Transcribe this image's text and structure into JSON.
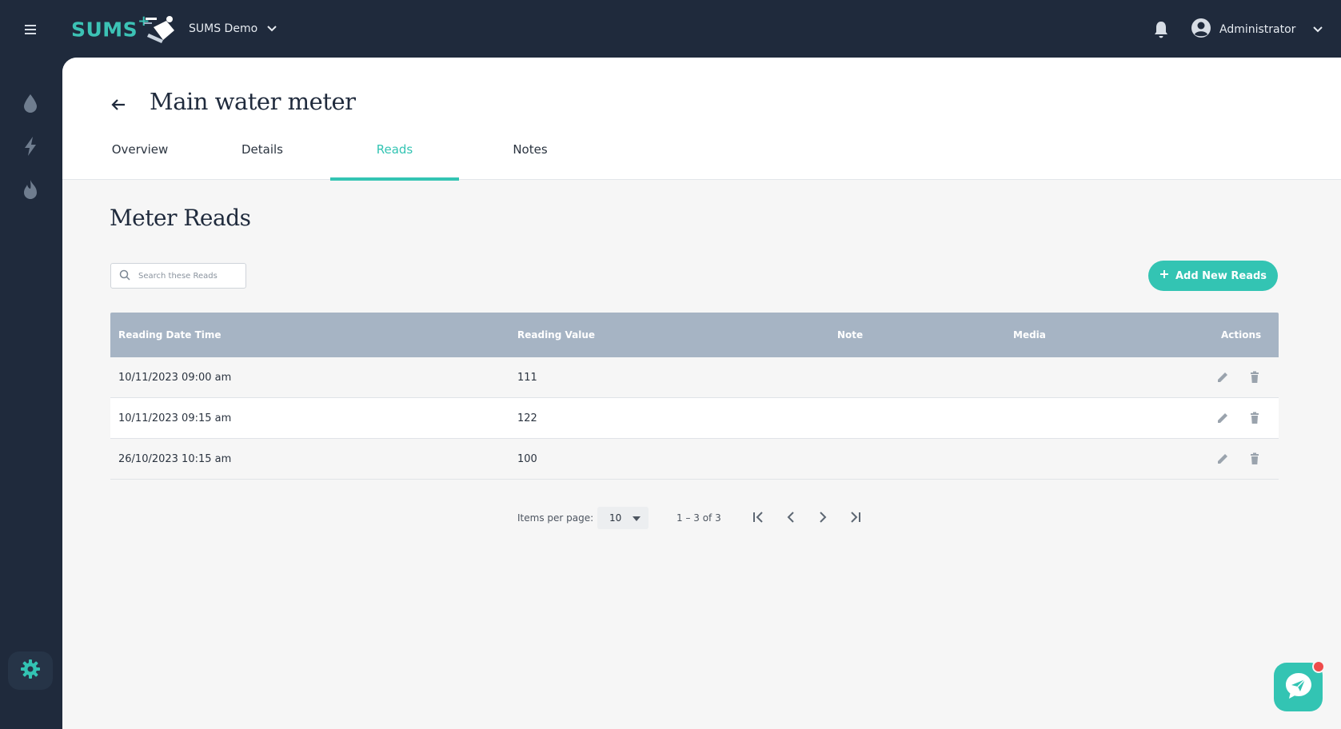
{
  "brand": {
    "logo_text": "SUMS",
    "logo_sup": "+",
    "org_name": "SUMS Demo"
  },
  "user": {
    "name": "Administrator"
  },
  "colors": {
    "accent": "#33c4b3",
    "dark": "#1f2a3c",
    "table_header": "#a6b4c4",
    "notification": "#ef4b4b"
  },
  "page": {
    "title": "Main water meter"
  },
  "tabs": [
    {
      "label": "Overview"
    },
    {
      "label": "Details"
    },
    {
      "label": "Reads"
    },
    {
      "label": "Notes"
    }
  ],
  "active_tab": "Reads",
  "section": {
    "title": "Meter Reads"
  },
  "search": {
    "placeholder": "Search these Reads"
  },
  "add_button": {
    "label": "Add New Reads"
  },
  "table": {
    "columns": [
      "Reading Date Time",
      "Reading Value",
      "Note",
      "Media",
      "Actions"
    ],
    "rows": [
      {
        "datetime": "10/11/2023 09:00 am",
        "value": "111",
        "note": "",
        "media": ""
      },
      {
        "datetime": "10/11/2023 09:15 am",
        "value": "122",
        "note": "",
        "media": ""
      },
      {
        "datetime": "26/10/2023 10:15 am",
        "value": "100",
        "note": "",
        "media": ""
      }
    ]
  },
  "pagination": {
    "items_per_page_label": "Items per page:",
    "items_per_page": "10",
    "range": "1 – 3 of 3"
  },
  "icons": {
    "menu": "hamburger-icon",
    "org_dropdown": "chevron-down-icon",
    "notifications": "bell-icon",
    "user": "account-circle-icon",
    "rail": [
      "water-drop-icon",
      "lightning-icon",
      "flame-icon"
    ],
    "settings": "gear-icon",
    "back": "arrow-left-icon",
    "search": "search-icon",
    "add": "plus-icon",
    "edit": "pencil-icon",
    "delete": "trash-icon",
    "chat": "paper-plane-icon"
  }
}
